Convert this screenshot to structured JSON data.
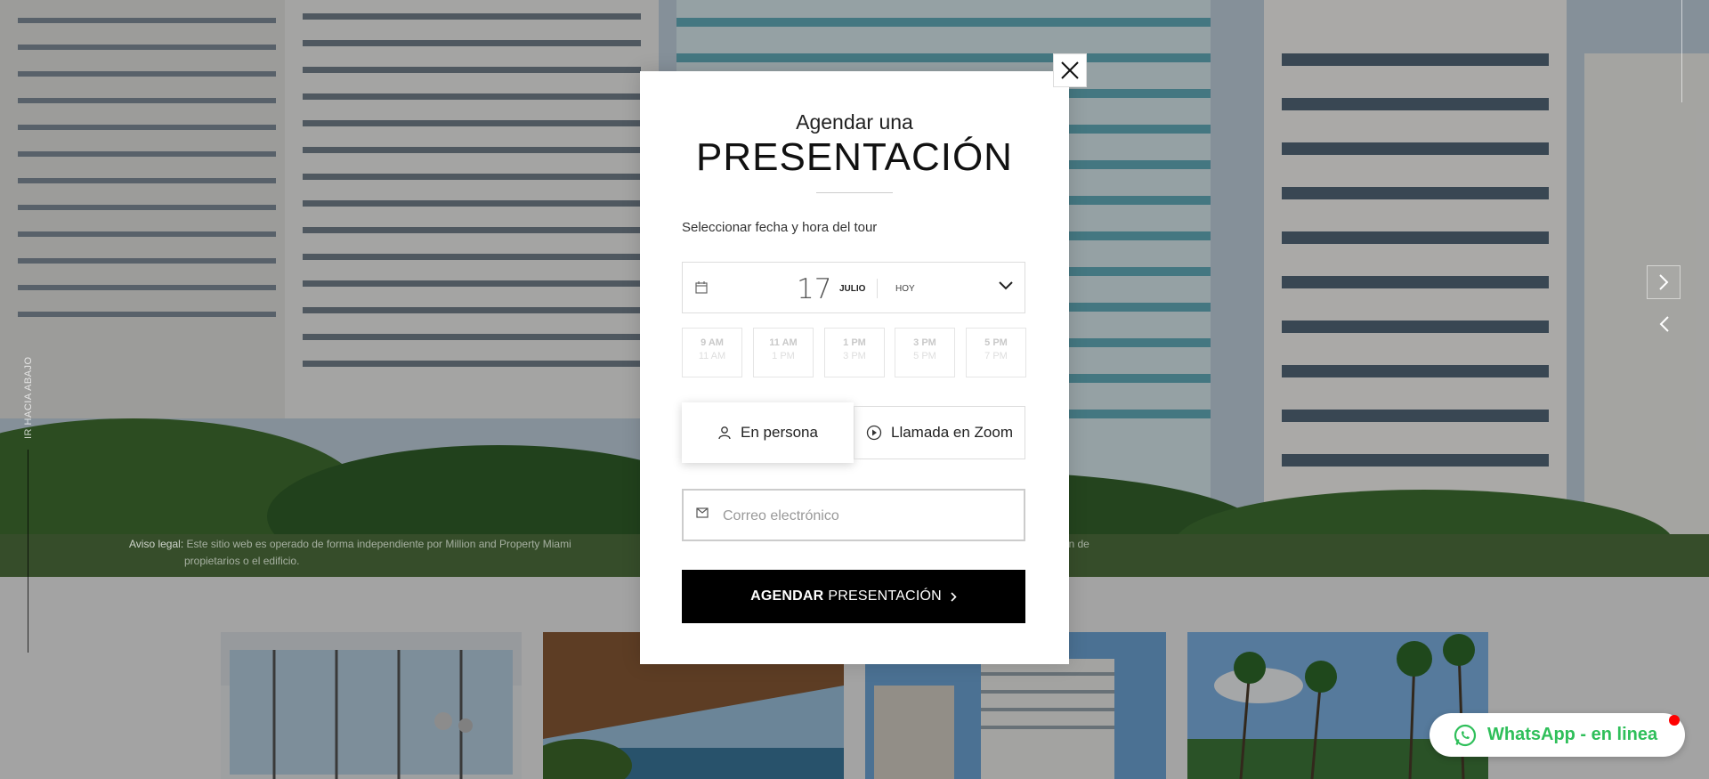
{
  "hero": {
    "disclaimer_label": "Aviso legal:",
    "disclaimer_text": "Este sitio web es operado de forma independiente por Million and Property Miami",
    "disclaimer_text_2": "con la asociación de",
    "disclaimer_text_3": "propietarios o el edificio."
  },
  "scroll": {
    "label": "IR HACIA ABAJO"
  },
  "modal": {
    "subtitle": "Agendar una",
    "title": "PRESENTACIÓN",
    "select_label": "Seleccionar fecha y hora del tour",
    "date": {
      "day": "17",
      "month": "JULIO",
      "relative": "HOY"
    },
    "slots": [
      {
        "from": "9 AM",
        "to": "11 AM"
      },
      {
        "from": "11 AM",
        "to": "1 PM"
      },
      {
        "from": "1 PM",
        "to": "3 PM"
      },
      {
        "from": "3 PM",
        "to": "5 PM"
      },
      {
        "from": "5 PM",
        "to": "7 PM"
      }
    ],
    "mode_in_person": "En persona",
    "mode_zoom": "Llamada en Zoom",
    "email_placeholder": "Correo electrónico",
    "submit_bold": "AGENDAR",
    "submit_rest": "PRESENTACIÓN"
  },
  "whatsapp": {
    "label": "WhatsApp - en linea"
  },
  "colors": {
    "whatsapp_green": "#2fbf5a",
    "notify_red": "#ff0000",
    "submit_bg": "#000000"
  }
}
